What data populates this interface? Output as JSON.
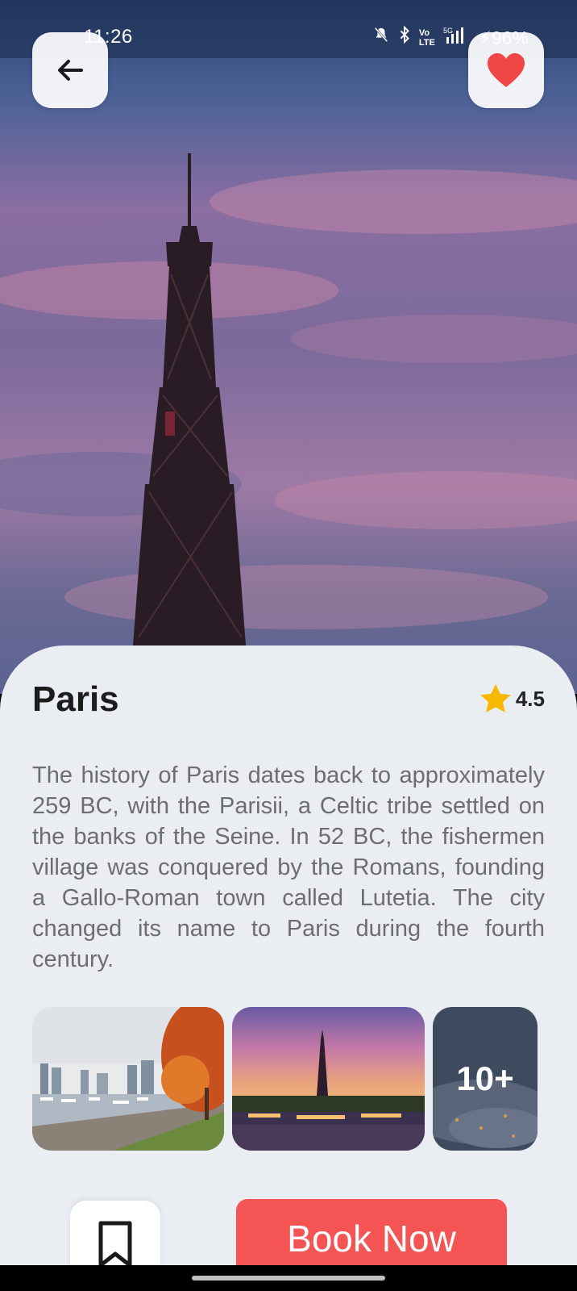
{
  "status_bar": {
    "time": "11:26",
    "battery": "96%"
  },
  "place": {
    "title": "Paris",
    "rating": "4.5",
    "description": "The history of Paris dates back to approximately 259 BC, with the Parisii, a Celtic tribe settled on the banks of the Seine. In 52 BC, the fishermen village was conquered by the Romans, founding a Gallo-Roman town called Lutetia. The city changed its name to Paris during the fourth century."
  },
  "gallery": {
    "more_label": "10+"
  },
  "actions": {
    "book_label": "Book Now"
  },
  "colors": {
    "accent": "#f45454",
    "favorite": "#f04646",
    "star": "#f6b800",
    "sheet_bg": "#eaeef3"
  },
  "icons": [
    "back-arrow-icon",
    "heart-icon",
    "star-icon",
    "bookmark-icon",
    "mute-icon",
    "bluetooth-icon",
    "signal-icon",
    "battery-charging-icon"
  ]
}
